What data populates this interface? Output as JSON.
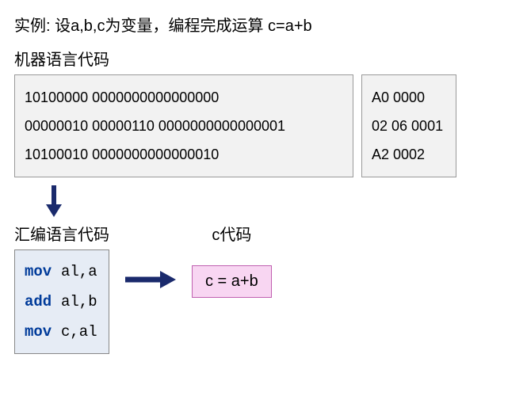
{
  "title": "实例: 设a,b,c为变量，编程完成运算 c=a+b",
  "machine_section_label": "机器语言代码",
  "machine_lines": [
    "10100000 0000000000000000",
    "00000010 00000110 0000000000000001",
    "10100010 0000000000000010"
  ],
  "hex_lines": [
    "A0 0000",
    "02 06 0001",
    "A2 0002"
  ],
  "asm_section_label": "汇编语言代码",
  "asm_lines": [
    {
      "op": "mov",
      "args": "al,a"
    },
    {
      "op": "add",
      "args": "al,b"
    },
    {
      "op": "mov",
      "args": "c,al"
    }
  ],
  "c_section_label": "c代码",
  "c_code": "c = a+b",
  "arrow_color": "#1a2a6c"
}
